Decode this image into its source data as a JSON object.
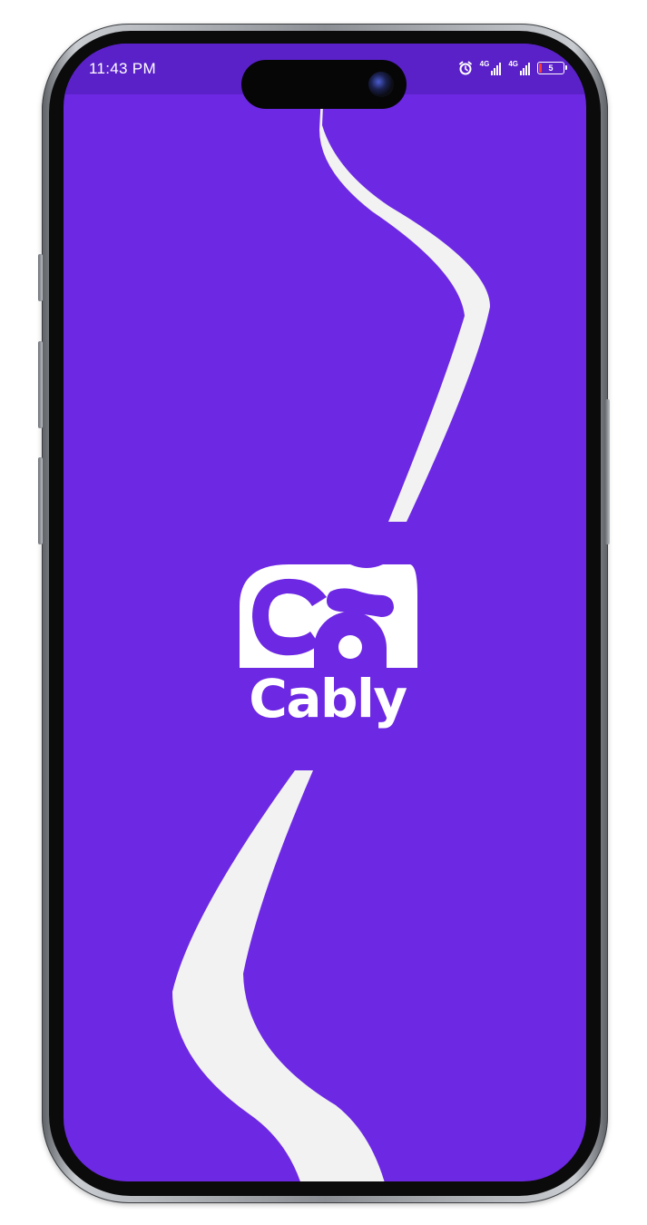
{
  "status_bar": {
    "time": "11:43 PM",
    "network_1": "4G",
    "network_2": "4G",
    "battery_level": "5",
    "icons": [
      "alarm-icon",
      "signal-icon",
      "signal-icon",
      "battery-icon"
    ]
  },
  "splash": {
    "brand_name": "Cably",
    "logo_icon": "cably-logo-icon"
  },
  "colors": {
    "background": "#6d28e3",
    "status_bar": "#5a21c9",
    "accent": "#f2f2f2",
    "battery_low": "#ff3b30"
  }
}
